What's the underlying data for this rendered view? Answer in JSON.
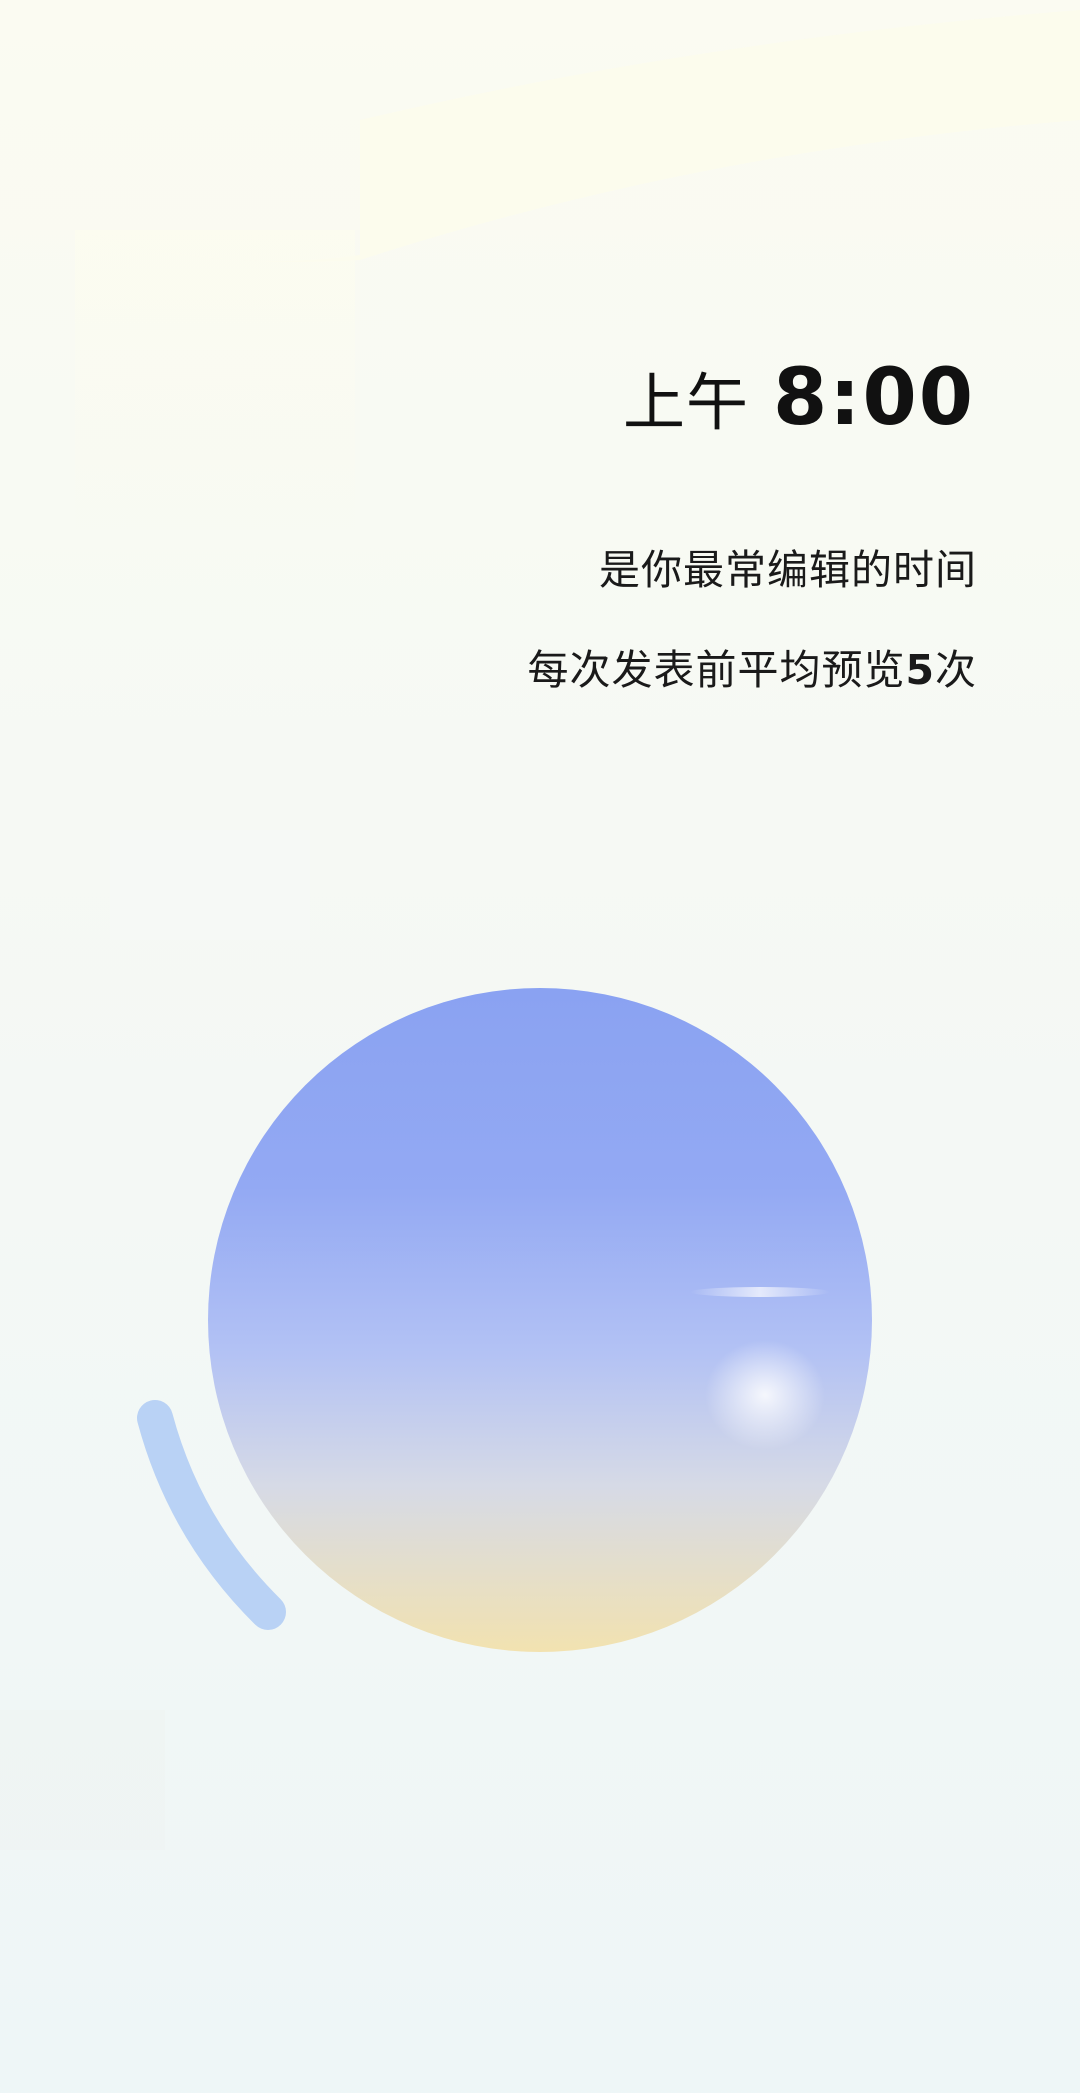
{
  "summary": {
    "time_prefix": "上午",
    "time_value": "8:00",
    "line1": "是你最常编辑的时间",
    "line2_prefix": "每次发表前平均预览",
    "line2_count": "5",
    "line2_suffix": "次"
  },
  "colors": {
    "text": "#111111",
    "orb_top": "#8aa2f2",
    "orb_bottom": "#f2e2b0",
    "arc": "#b9d2f5"
  }
}
